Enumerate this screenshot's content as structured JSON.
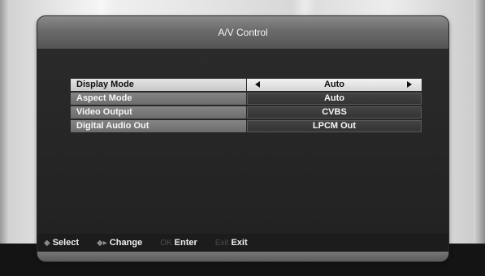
{
  "window": {
    "title": "A/V Control"
  },
  "settings": [
    {
      "label": "Display Mode",
      "value": "Auto",
      "selected": true
    },
    {
      "label": "Aspect Mode",
      "value": "Auto",
      "selected": false
    },
    {
      "label": "Video Output",
      "value": "CVBS",
      "selected": false
    },
    {
      "label": "Digital Audio Out",
      "value": "LPCM Out",
      "selected": false
    }
  ],
  "footer": {
    "select": {
      "key": "◆",
      "label": "Select"
    },
    "change": {
      "key": "◆▸",
      "label": "Change"
    },
    "enter": {
      "key": "OK",
      "label": "Enter"
    },
    "exit": {
      "key": "Exit",
      "label": "Exit"
    }
  },
  "icons": {
    "select": "updown-arrows-icon",
    "change": "leftright-arrows-icon",
    "value_left": "left-arrow-icon",
    "value_right": "right-arrow-icon"
  }
}
